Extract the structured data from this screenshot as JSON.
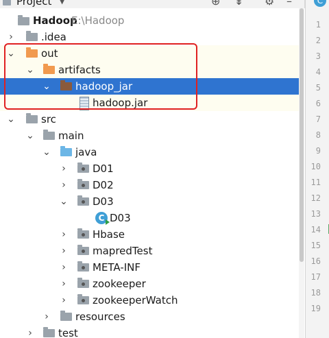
{
  "header": {
    "title": "Project"
  },
  "tree": [
    {
      "label": "Hadoop",
      "sublabel": "E:\\Hadoop"
    },
    {
      "label": ".idea"
    },
    {
      "label": "out"
    },
    {
      "label": "artifacts"
    },
    {
      "label": "hadoop_jar"
    },
    {
      "label": "hadoop.jar"
    },
    {
      "label": "src"
    },
    {
      "label": "main"
    },
    {
      "label": "java"
    },
    {
      "label": "D01"
    },
    {
      "label": "D02"
    },
    {
      "label": "D03"
    },
    {
      "label": "D03"
    },
    {
      "label": "Hbase"
    },
    {
      "label": "mapredTest"
    },
    {
      "label": "META-INF"
    },
    {
      "label": "zookeeper"
    },
    {
      "label": "zookeeperWatch"
    },
    {
      "label": "resources"
    },
    {
      "label": "test"
    }
  ],
  "gutter": [
    "1",
    "2",
    "3",
    "4",
    "5",
    "6",
    "7",
    "8",
    "9",
    "10",
    "11",
    "12",
    "13",
    "14",
    "15",
    "16",
    "17",
    "18",
    "19"
  ],
  "colors": {
    "selection": "#2f74d0",
    "highlight_box": "#e02020",
    "excluded_folder": "#f19a4f",
    "source_folder": "#6cb6e6"
  }
}
